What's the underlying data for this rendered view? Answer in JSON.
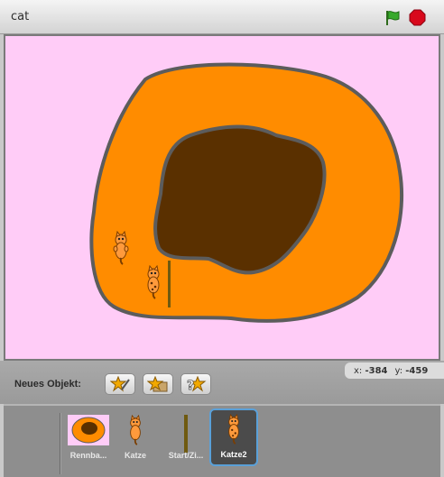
{
  "window": {
    "title": "cat"
  },
  "toolbar": {
    "green_flag_icon": "green-flag-icon",
    "stop_icon": "stop-sign-icon"
  },
  "stage": {
    "background_color": "#ffccf7",
    "track_color": "#ff8c00",
    "infield_color": "#5a3000"
  },
  "status": {
    "x_label": "x:",
    "x_value": "-384",
    "y_label": "y:",
    "y_value": "-459"
  },
  "new_sprite": {
    "label": "Neues Objekt:",
    "buttons": [
      {
        "icon": "paint-new-sprite-icon"
      },
      {
        "icon": "choose-sprite-from-file-icon"
      },
      {
        "icon": "surprise-sprite-icon"
      }
    ]
  },
  "sprites": [
    {
      "name": "Rennba...",
      "selected": false
    },
    {
      "name": "Katze",
      "selected": false
    },
    {
      "name": "Start/Zi...",
      "selected": false
    },
    {
      "name": "Katze2",
      "selected": true
    }
  ]
}
